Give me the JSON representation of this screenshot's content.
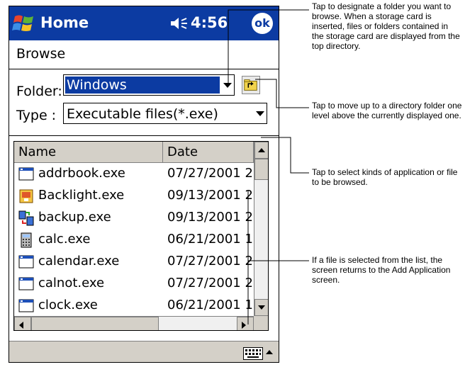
{
  "titlebar": {
    "title": "Home",
    "time": "4:56",
    "ok_label": "ok",
    "bg_color": "#0c3ba2"
  },
  "page": {
    "heading": "Browse"
  },
  "form": {
    "folder_label": "Folder:",
    "folder_value": "Windows",
    "type_label": "Type :",
    "type_value": "Executable files(*.exe)"
  },
  "list": {
    "columns": [
      "Name",
      "Date"
    ],
    "rows": [
      {
        "name": "addrbook.exe",
        "date": "07/27/2001 2",
        "icon": "app-window-icon"
      },
      {
        "name": "Backlight.exe",
        "date": "09/13/2001 2",
        "icon": "backlight-icon"
      },
      {
        "name": "backup.exe",
        "date": "09/13/2001 2",
        "icon": "backup-icon"
      },
      {
        "name": "calc.exe",
        "date": "06/21/2001 1",
        "icon": "calculator-icon"
      },
      {
        "name": "calendar.exe",
        "date": "07/27/2001 2",
        "icon": "app-window-icon"
      },
      {
        "name": "calnot.exe",
        "date": "07/27/2001 2",
        "icon": "app-window-icon"
      },
      {
        "name": "clock.exe",
        "date": "06/21/2001 1",
        "icon": "app-window-icon"
      }
    ]
  },
  "callouts": [
    "Tap to designate a folder you want to browse. When a storage card is inserted, files or folders contained in the storage card are displayed from the top directory.",
    "Tap to move up to a directory folder one level above the currently displayed one.",
    "Tap to select kinds of application or file to be browsed.",
    "If a file is selected from the list, the screen returns to the Add Application screen."
  ]
}
